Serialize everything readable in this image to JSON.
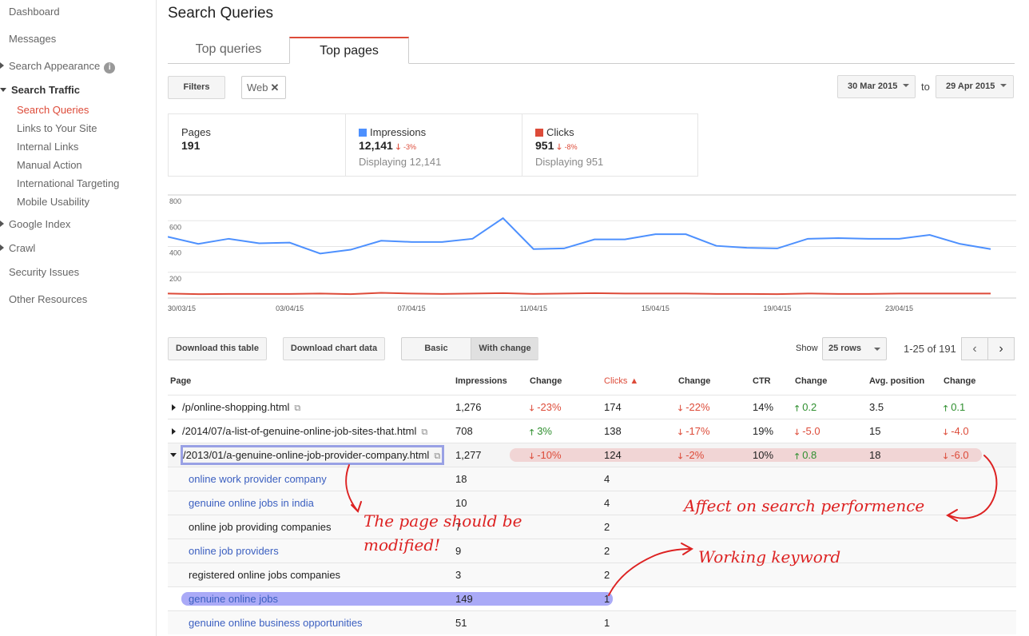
{
  "sidebar": {
    "dashboard": "Dashboard",
    "messages": "Messages",
    "search_appearance": "Search Appearance",
    "search_traffic": "Search Traffic",
    "sub": [
      "Search Queries",
      "Links to Your Site",
      "Internal Links",
      "Manual Action",
      "International Targeting",
      "Mobile Usability"
    ],
    "google_index": "Google Index",
    "crawl": "Crawl",
    "security": "Security Issues",
    "other": "Other Resources"
  },
  "page_title": "Search Queries",
  "tabs": [
    "Top queries",
    "Top pages"
  ],
  "filters": {
    "filters_label": "Filters",
    "chip": "Web",
    "date_from": "30 Mar 2015",
    "to": "to",
    "date_to": "29 Apr 2015"
  },
  "summary": {
    "pages": {
      "label": "Pages",
      "value": "191"
    },
    "impressions": {
      "label": "Impressions",
      "value": "12,141",
      "change": "-3%",
      "display": "Displaying 12,141",
      "color": "#4d90fe"
    },
    "clicks": {
      "label": "Clicks",
      "value": "951",
      "change": "-8%",
      "display": "Displaying 951",
      "color": "#dd4b39"
    }
  },
  "chart_data": {
    "type": "line",
    "x": [
      "30/03/15",
      "31/03/15",
      "01/04/15",
      "02/04/15",
      "03/04/15",
      "04/04/15",
      "05/04/15",
      "06/04/15",
      "07/04/15",
      "08/04/15",
      "09/04/15",
      "10/04/15",
      "11/04/15",
      "12/04/15",
      "13/04/15",
      "14/04/15",
      "15/04/15",
      "16/04/15",
      "17/04/15",
      "18/04/15",
      "19/04/15",
      "20/04/15",
      "21/04/15",
      "22/04/15",
      "23/04/15",
      "24/04/15",
      "25/04/15",
      "26/04/15"
    ],
    "series": [
      {
        "name": "Impressions",
        "color": "#4d90fe",
        "values": [
          475,
          420,
          460,
          425,
          430,
          345,
          375,
          445,
          435,
          435,
          460,
          620,
          380,
          385,
          455,
          455,
          495,
          495,
          405,
          390,
          385,
          460,
          465,
          460,
          460,
          490,
          420,
          380
        ]
      },
      {
        "name": "Clicks",
        "color": "#dd4b39",
        "values": [
          35,
          30,
          32,
          32,
          32,
          35,
          30,
          40,
          35,
          32,
          35,
          38,
          32,
          35,
          38,
          35,
          35,
          35,
          32,
          32,
          30,
          35,
          32,
          32,
          35,
          35,
          35,
          35
        ]
      }
    ],
    "yticks": [
      "800",
      "600",
      "400",
      "200"
    ],
    "xtick_labels": [
      "30/03/15",
      "03/04/15",
      "07/04/15",
      "11/04/15",
      "15/04/15",
      "19/04/15",
      "23/04/15"
    ],
    "ylim": [
      0,
      800
    ],
    "grid": true
  },
  "toolbar": {
    "download_table": "Download this table",
    "download_chart": "Download chart data",
    "basic": "Basic",
    "with_change": "With change",
    "show": "Show",
    "rows": "25 rows",
    "pager": "1-25 of 191",
    "prev": "‹",
    "next": "›"
  },
  "table": {
    "headers": [
      "Page",
      "Impressions",
      "Change",
      "Clicks ▲",
      "Change",
      "CTR",
      "Change",
      "Avg. position",
      "Change"
    ],
    "rows": [
      {
        "page": "/p/online-shopping.html",
        "impr": "1,276",
        "impr_chg": "-23%",
        "clicks": "174",
        "clicks_chg": "-22%",
        "ctr": "14%",
        "ctr_chg": "0.2",
        "pos": "3.5",
        "pos_chg": "0.1"
      },
      {
        "page": "/2014/07/a-list-of-genuine-online-job-sites-that.html",
        "impr": "708",
        "impr_chg": "3%",
        "clicks": "138",
        "clicks_chg": "-17%",
        "ctr": "19%",
        "ctr_chg": "-5.0",
        "pos": "15",
        "pos_chg": "-4.0"
      },
      {
        "page": "/2013/01/a-genuine-online-job-provider-company.html",
        "impr": "1,277",
        "impr_chg": "-10%",
        "clicks": "124",
        "clicks_chg": "-2%",
        "ctr": "10%",
        "ctr_chg": "0.8",
        "pos": "18",
        "pos_chg": "-6.0"
      }
    ],
    "subrows": [
      {
        "query": "online work provider company",
        "impr": "18",
        "clicks": "4"
      },
      {
        "query": "genuine online jobs in india",
        "impr": "10",
        "clicks": "4"
      },
      {
        "query": "online job providing companies",
        "impr": "7",
        "clicks": "2"
      },
      {
        "query": "online job providers",
        "impr": "9",
        "clicks": "2"
      },
      {
        "query": "registered online jobs companies",
        "impr": "3",
        "clicks": "2"
      },
      {
        "query": "genuine online jobs",
        "impr": "149",
        "clicks": "1"
      },
      {
        "query": "genuine online business opportunities",
        "impr": "51",
        "clicks": "1"
      }
    ]
  },
  "annotations": {
    "page_modify_1": "The page should be",
    "page_modify_2": "modified!",
    "affect": "Affect on search performence",
    "working": "Working keyword"
  }
}
